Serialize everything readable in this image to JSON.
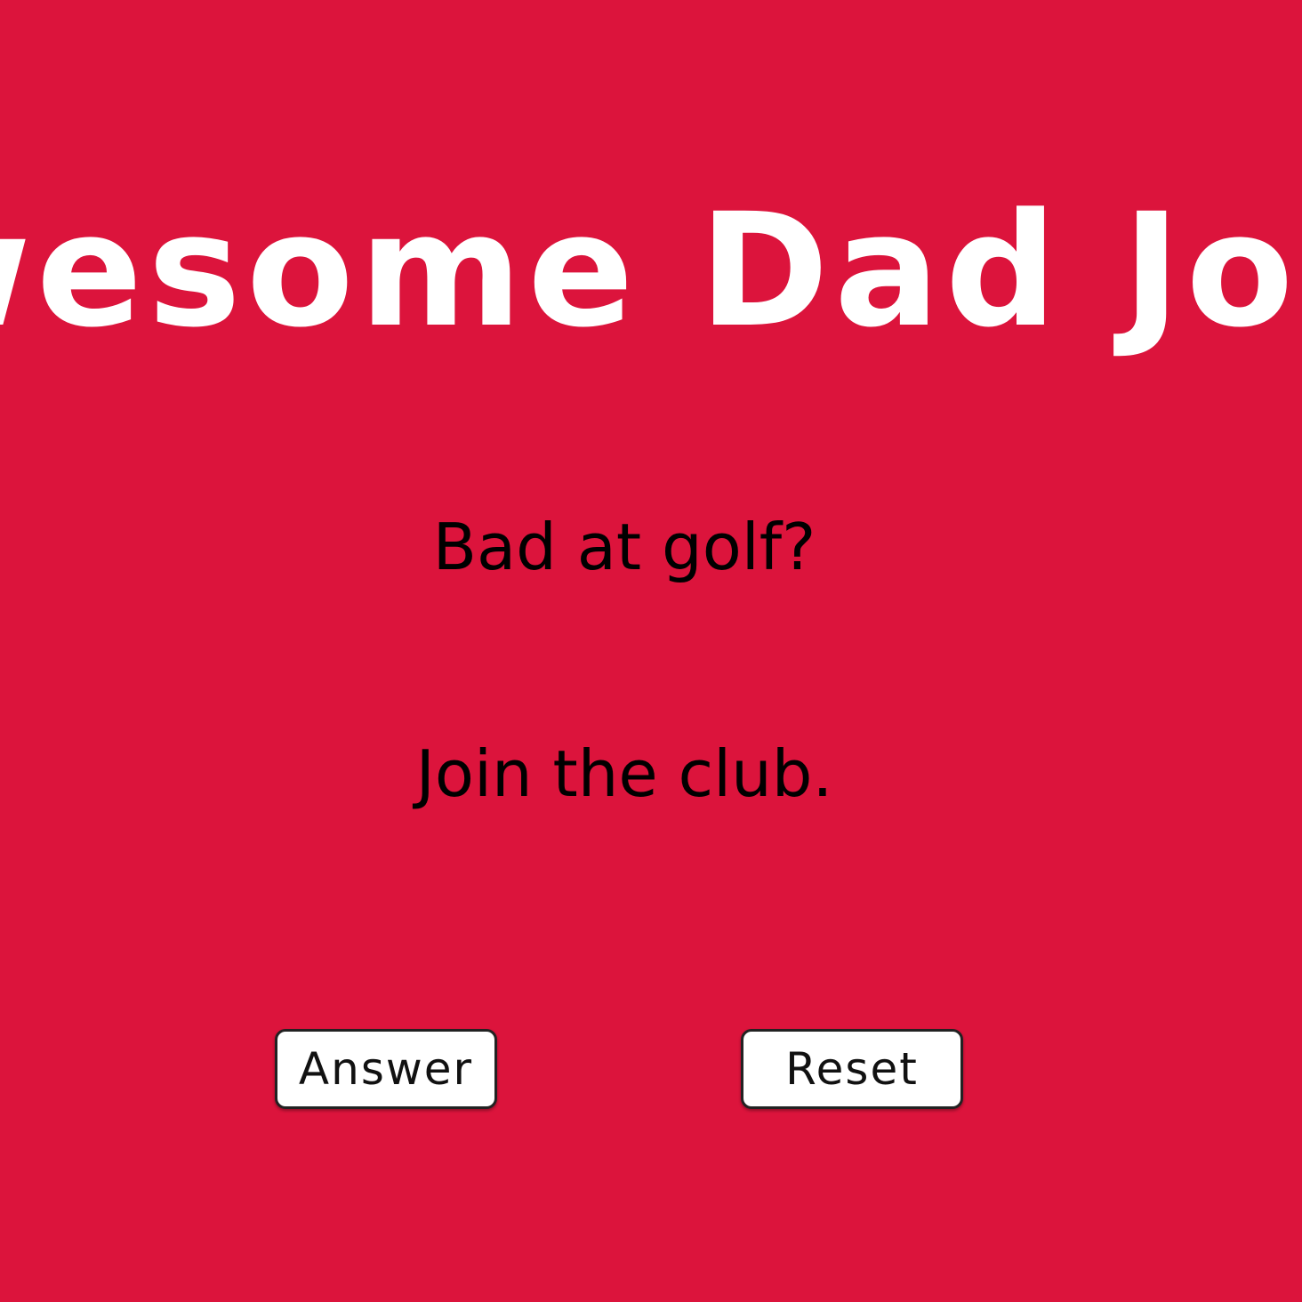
{
  "header": {
    "title": "Awesome Dad Jokes"
  },
  "joke": {
    "question": "Bad at golf?",
    "answer": "Join the club."
  },
  "buttons": {
    "answer_label": "Answer",
    "reset_label": "Reset"
  },
  "colors": {
    "background": "#dc143c",
    "title": "#ffffff",
    "text": "#000000",
    "button_background": "#ffffff"
  }
}
